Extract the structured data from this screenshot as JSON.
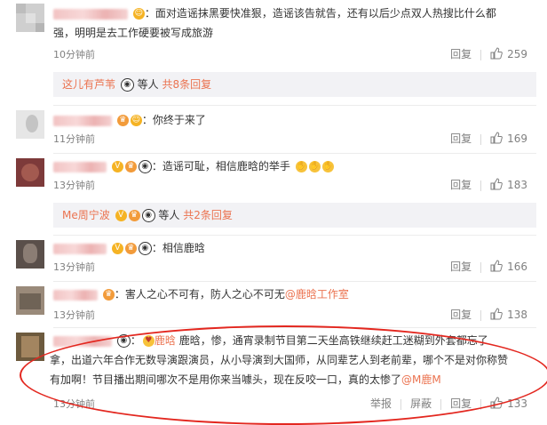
{
  "comments": [
    {
      "text": "面对造谣抹黑要快准狠，造谣该告就告，还有以后少点双人热搜比什么都",
      "text2": "强，明明是去工作硬要被写成旅游",
      "time": "10分钟前",
      "reply_label": "回复",
      "likes": "259",
      "sub": {
        "who": "这儿有芦苇",
        "mid": "等人",
        "more": "共8条回复"
      }
    },
    {
      "text": "你终于来了",
      "time": "11分钟前",
      "reply_label": "回复",
      "likes": "169"
    },
    {
      "text": "造谣可耻，相信鹿晗的举手",
      "time": "13分钟前",
      "reply_label": "回复",
      "likes": "183",
      "sub": {
        "who": "Me周宁波",
        "mid": "等人",
        "more": "共2条回复"
      }
    },
    {
      "text": "相信鹿晗",
      "time": "13分钟前",
      "reply_label": "回复",
      "likes": "166"
    },
    {
      "text": "害人之心不可有，防人之心不可无",
      "mention": "@鹿晗工作室",
      "time": "13分钟前",
      "reply_label": "回复",
      "likes": "138"
    },
    {
      "mention_lead": "鹿晗",
      "text": "鹿晗，惨，通宵录制节目第二天坐高铁继续赶工迷糊到外套都忘了",
      "text2": "拿，出道六年合作无数导演跟演员，从小导演到大国师，从同辈艺人到老前辈，哪个不是对你称赞",
      "text3": "有加啊！节目播出期间哪次不是用你来当噱头，现在反咬一口，真的太惨了",
      "mention": "@M鹿M",
      "time": "13分钟前",
      "report_label": "举报",
      "delete_label": "屏蔽",
      "reply_label": "回复",
      "likes": "133"
    }
  ],
  "colors": {
    "accent": "#eb7350",
    "highlight_oval": "#e3271f"
  }
}
